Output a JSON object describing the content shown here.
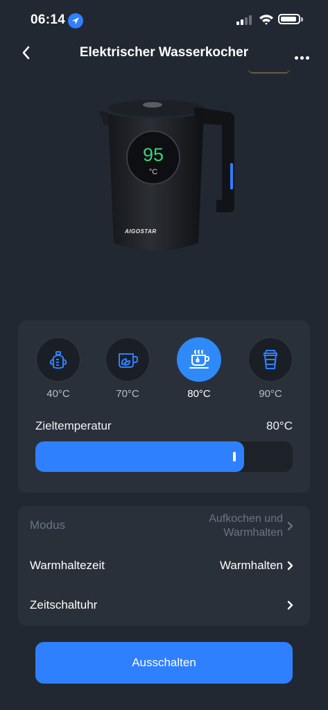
{
  "status_bar": {
    "time": "06:14"
  },
  "nav": {
    "title": "Elektrischer  Wasserkocher"
  },
  "device": {
    "display_temperature": "95",
    "display_unit": "°C",
    "brand": "AIGOSTAR"
  },
  "presets": [
    {
      "label": "40°C",
      "icon": "baby-bottle-icon",
      "active": false
    },
    {
      "label": "70°C",
      "icon": "tea-leaf-cup-icon",
      "active": false
    },
    {
      "label": "80°C",
      "icon": "hot-tea-cup-icon",
      "active": true
    },
    {
      "label": "90°C",
      "icon": "coffee-cup-icon",
      "active": false
    }
  ],
  "temperature": {
    "label": "Zieltemperatur",
    "value": "80°C",
    "slider_fraction": 0.81
  },
  "settings": {
    "modus_label": "Modus",
    "modus_value_line1": "Aufkochen und",
    "modus_value_line2": "Warmhalten",
    "warmhaltezeit_label": "Warmhaltezeit",
    "warmhaltezeit_value": "Warmhalten",
    "zeitschaltuhr_label": "Zeitschaltuhr",
    "chevron": "›"
  },
  "actions": {
    "off_button": "Ausschalten"
  },
  "colors": {
    "accent": "#2f80ff",
    "background": "#222831",
    "card": "#2a3039",
    "display_green": "#3ecf7a"
  }
}
